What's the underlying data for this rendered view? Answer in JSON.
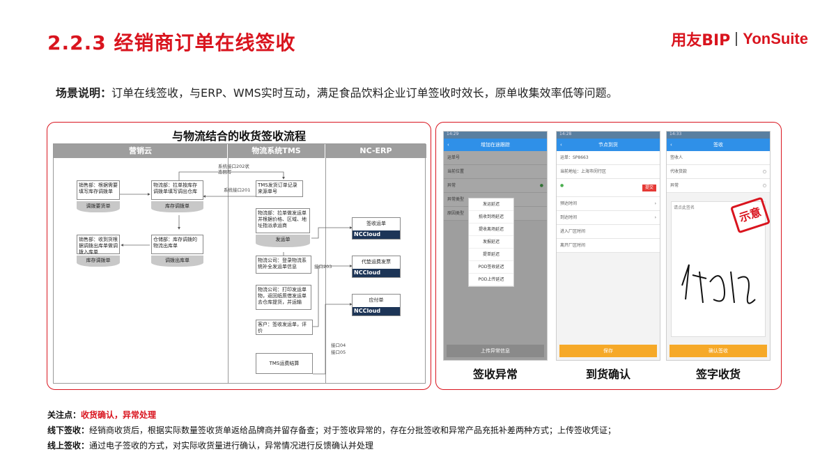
{
  "header": {
    "title": "2.2.3 经销商订单在线签收",
    "brand_cn": "用友BIP",
    "brand_en": "YonSuite"
  },
  "scenario": {
    "label": "场景说明：",
    "text": "订单在线签收，与ERP、WMS实时互动，满足食品饮料企业订单签收时效长，原单收集效率低等问题。"
  },
  "flow": {
    "title": "与物流结合的收货签收流程",
    "lanes": [
      "营销云",
      "物流系统TMS",
      "NC-ERP"
    ],
    "boxes": {
      "b1": "销售部：根据需要填写库存调拨单",
      "b2": "物流部：拉单按库存调拨单填写调出仓库",
      "b3": "销售部：收到货根据调拨出库单做调拨入库单",
      "b4": "仓储部：库存调拨的物流出库单",
      "b5": "TMS发货订单记录来源单号",
      "b6": "物流部：拉单做发运单并根据价格、区域、地址指派承运商",
      "b7": "物流公司：登录物流系统补全发运单信息",
      "b8": "物流公司：打印发运单物，返回纸质借发运单去仓库提货，并运输",
      "b9": "客户：签收发运单，评价",
      "b10": "TMS运费结算"
    },
    "docs": {
      "d1": "调拨要货单",
      "d2": "库存调拨单",
      "d3": "库存调拨单",
      "d4": "调拨出库单",
      "d5": "发运单"
    },
    "nc": {
      "n1": "签收运单",
      "n2": "代垫运费发票",
      "n3": "应付单",
      "badge": "NCCloud"
    },
    "labels": {
      "l1": "系统接口202状态回写",
      "l2": "系统接口201",
      "l3": "接口203",
      "l4": "接口04",
      "l5": "接口05"
    }
  },
  "phones": [
    {
      "caption": "签收异常",
      "bar_title": "增加在途跟踪",
      "rows": [
        "运单号",
        "当前位置",
        "异常",
        "异常类型",
        "原因类型"
      ],
      "popup": [
        "发运延迟",
        "抵收到场延迟",
        "提收离场延迟",
        "发报延迟",
        "提单延迟",
        "POD签收延迟",
        "POD上传延迟"
      ],
      "button": "上传异常信息"
    },
    {
      "caption": "到货确认",
      "bar_title": "节点到货",
      "rows": [
        "运单：SP8663",
        "当前地址：上海市闵行区",
        "预达时间",
        "到达时间",
        "进入厂区时间",
        "离开厂区时间"
      ],
      "button": "保存"
    },
    {
      "caption": "签字收货",
      "bar_title": "签收",
      "rows": [
        "签收人",
        "代收货款",
        "异常",
        "请点此签名"
      ],
      "stamp": "示意",
      "button": "确认签收"
    }
  ],
  "notes": {
    "focus_label": "关注点：",
    "focus_text": "收货确认，异常处理",
    "offline_label": "线下签收：",
    "offline_text": "经销商收货后，根据实际数量签收货单返给品牌商并留存备查；对于签收异常的，存在分批签收和异常产品充抵补差两种方式；上传签收凭证；",
    "online_label": "线上签收：",
    "online_text": "通过电子签收的方式，对实际收货量进行确认，异常情况进行反馈确认并处理"
  }
}
